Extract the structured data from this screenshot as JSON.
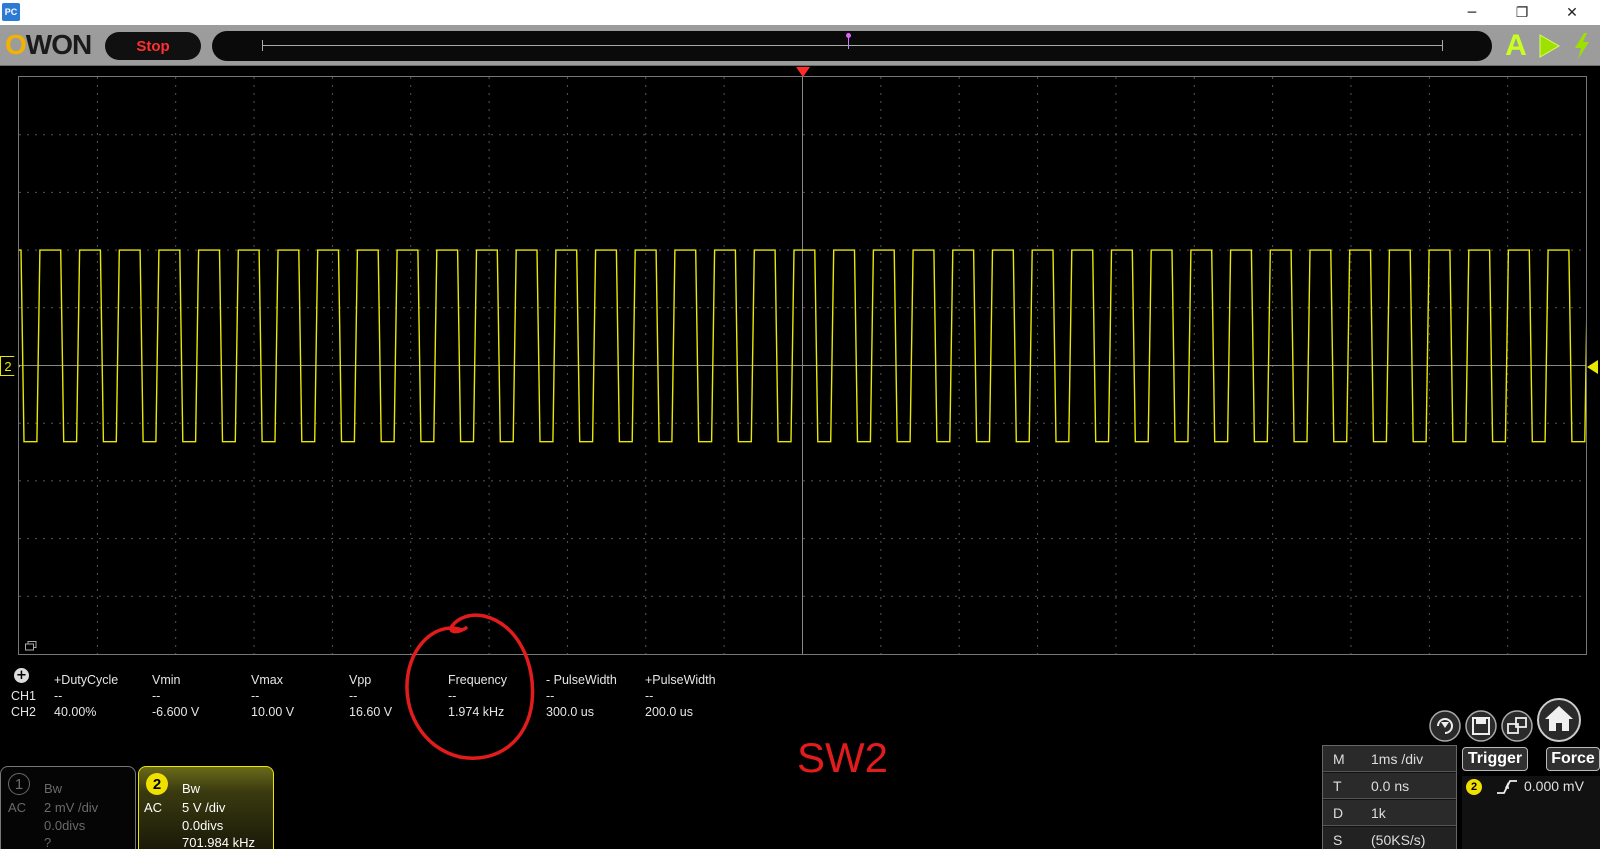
{
  "window": {
    "app_icon_label": "PC",
    "minimize": "─",
    "restore": "❐",
    "close": "✕"
  },
  "toolbar": {
    "logo": "OWON",
    "run_state": "Stop",
    "auto_label": "A"
  },
  "channels": [
    {
      "number": "1",
      "bw": "Bw",
      "coupling": "AC",
      "scale": "2 mV /div",
      "offset": "0.0divs",
      "freq": "?",
      "active": false
    },
    {
      "number": "2",
      "bw": "Bw",
      "coupling": "AC",
      "scale": "5 V /div",
      "offset": "0.0divs",
      "freq": "701.984 kHz",
      "active": true
    }
  ],
  "measurements": {
    "headers": [
      "+DutyCycle",
      "Vmin",
      "Vmax",
      "Vpp",
      "Frequency",
      "- PulseWidth",
      "+PulseWidth"
    ],
    "rows": [
      {
        "label": "CH1",
        "values": [
          "--",
          "--",
          "--",
          "--",
          "--",
          "--",
          "--"
        ]
      },
      {
        "label": "CH2",
        "values": [
          "40.00%",
          "-6.600 V",
          "10.00 V",
          "16.60 V",
          "1.974 kHz",
          "300.0 us",
          "200.0 us"
        ]
      }
    ]
  },
  "annotation": {
    "text": "SW2",
    "color": "#e21c1c"
  },
  "horizontal": {
    "rows": [
      {
        "key": "M",
        "value": "1ms /div"
      },
      {
        "key": "T",
        "value": "0.0 ns"
      },
      {
        "key": "D",
        "value": "1k"
      },
      {
        "key": "S",
        "value": "(50KS/s)"
      }
    ]
  },
  "trigger": {
    "button": "Trigger",
    "force": "Force",
    "channel": "2",
    "level": "0.000 mV",
    "slope_icon": "rising-edge-icon"
  },
  "waveform": {
    "channel": "CH2",
    "color": "#e8e800",
    "frequency_khz": 1.974,
    "duty_cycle": 0.4,
    "vmax_v": 10.0,
    "vmin_v": -6.6,
    "volts_per_div": 5,
    "time_per_div_ms": 1
  },
  "colors": {
    "accent_yellow": "#e8e800",
    "stop_red": "#ff3030",
    "trigger_red": "#ff2a2a",
    "logo_orange": "#f2b300"
  }
}
